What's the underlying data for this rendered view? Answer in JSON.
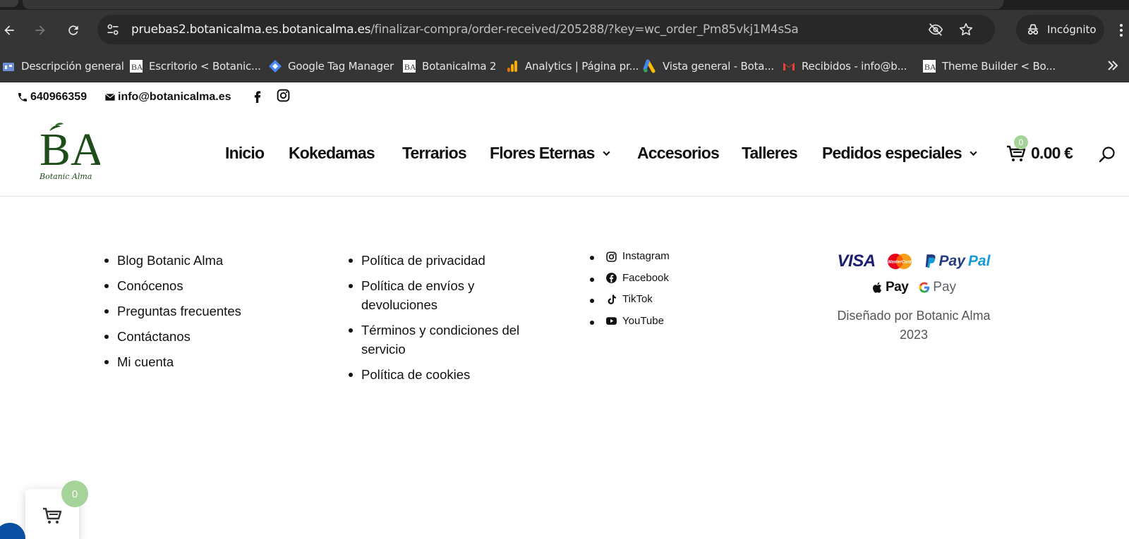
{
  "browser": {
    "url_host": "pruebas2.botanicalma.es.botanicalma.es",
    "url_path": "/finalizar-compra/order-received/205288/?key=wc_order_Pm85vkj1M4sSa",
    "incognito_label": "Incógnito",
    "bookmarks": [
      {
        "label": "Descripción general",
        "icon": "overview-icon"
      },
      {
        "label": "Escritorio < Botanic...",
        "icon": "ba-favicon"
      },
      {
        "label": "Google Tag Manager",
        "icon": "gtm-icon"
      },
      {
        "label": "Botanicalma 2",
        "icon": "ba-favicon"
      },
      {
        "label": "Analytics | Página pr...",
        "icon": "analytics-icon"
      },
      {
        "label": "Vista general - Bota...",
        "icon": "google-ads-icon"
      },
      {
        "label": "Recibidos - info@b...",
        "icon": "gmail-icon"
      },
      {
        "label": "Theme Builder < Bo...",
        "icon": "ba-favicon"
      }
    ]
  },
  "topbar": {
    "phone": "640966359",
    "email": "info@botanicalma.es"
  },
  "logo": {
    "monogram": "BA",
    "script": "Botanic Alma"
  },
  "nav": {
    "items": [
      "Inicio",
      "Kokedamas",
      "Terrarios",
      "Flores Eternas",
      "Accesorios",
      "Talleres",
      "Pedidos especiales"
    ],
    "cart_count": "0",
    "cart_total": "0.00 €"
  },
  "footer": {
    "col1": [
      "Blog Botanic Alma",
      "Conócenos",
      "Preguntas frecuentes",
      "Contáctanos",
      "Mi cuenta"
    ],
    "col2": [
      "Política de privacidad",
      "Política de envíos y devoluciones",
      "Términos y condiciones del servicio",
      "Política de cookies"
    ],
    "social": [
      "Instagram",
      "Facebook",
      "TikTok",
      "YouTube"
    ],
    "payments": {
      "visa": "VISA",
      "mastercard": "MasterCard",
      "paypal_a": "Pay",
      "paypal_b": "Pal",
      "apple_pay": "Pay",
      "google_pay": "Pay"
    },
    "credits": "Diseñado por Botanic Alma 2023"
  },
  "floating_cart": {
    "count": "0"
  },
  "colors": {
    "accent_green": "#a6d39a",
    "logo_green": "#1f4d1a",
    "chrome_dark": "#353535"
  }
}
